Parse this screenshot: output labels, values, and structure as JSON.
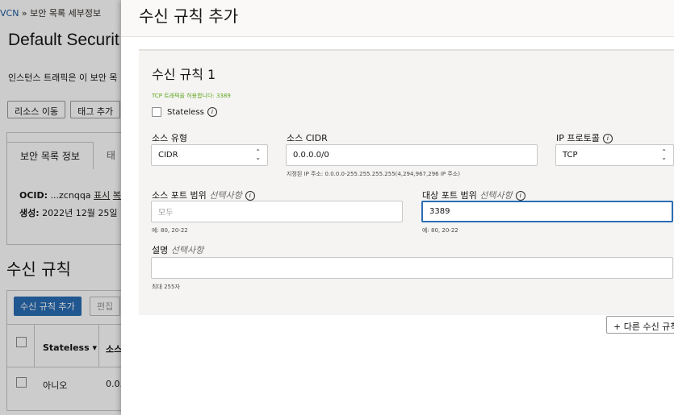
{
  "background": {
    "breadcrumb_link": "VCN",
    "breadcrumb_text": " » 보안 목록 세부정보",
    "title": "Default Securit",
    "description": "인스턴스 트래픽은 이 보안 목",
    "buttons": [
      "리소스 이동",
      "태그 추가"
    ],
    "tabs": [
      "보안 목록 정보",
      "태"
    ],
    "ocid_label": "OCID:",
    "ocid_value": "...zcnqqa",
    "ocid_show": "표시",
    "ocid_copy": "복",
    "created_label": "생성:",
    "created_value": "2022년 12월 25일 (",
    "section_title": "수신 규칙",
    "add_rule_button": "수신 규칙 추가",
    "edit_button": "편집",
    "columns": {
      "stateless": "Stateless ▾",
      "source": "소스"
    },
    "row": {
      "stateless": "아니오",
      "source": "0.0."
    }
  },
  "panel": {
    "title": "수신 규칙 추가",
    "rule_title": "수신 규칙 1",
    "allow_note": "TCP 트래픽을 허용합니다: 3389",
    "stateless_label": "Stateless",
    "source_type": {
      "label": "소스 유형",
      "value": "CIDR"
    },
    "source_cidr": {
      "label": "소스 CIDR",
      "value": "0.0.0.0/0",
      "hint": "지정된 IP 주소: 0.0.0.0-255.255.255.255(4,294,967,296 IP 주소)"
    },
    "ip_protocol": {
      "label": "IP 프로토콜",
      "value": "TCP"
    },
    "source_port": {
      "label": "소스 포트 범위",
      "optional": "선택사항",
      "placeholder": "모두",
      "hint": "예: 80, 20-22"
    },
    "dest_port": {
      "label": "대상 포트 범위",
      "optional": "선택사항",
      "value": "3389",
      "hint": "예: 80, 20-22"
    },
    "description": {
      "label": "설명",
      "optional": "선택사항",
      "hint": "최대 255자"
    },
    "add_another_button": "+ 다른 수신 규칙"
  },
  "colors": {
    "accent": "#2a6db5",
    "note_green": "#5fa520",
    "section_bg": "#f5f4f2"
  }
}
